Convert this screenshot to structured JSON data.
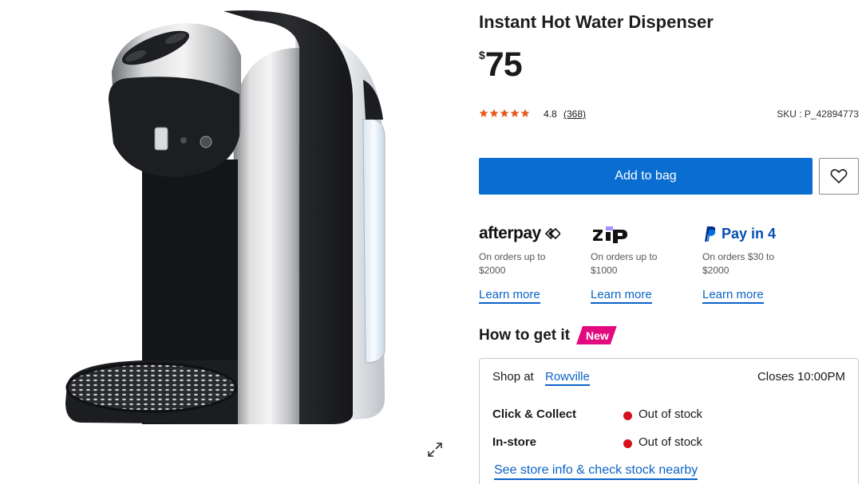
{
  "product": {
    "title": "Instant Hot Water Dispenser",
    "currency_symbol": "$",
    "price": "75",
    "rating": "4.8",
    "rating_count": "(368)",
    "stars": 5,
    "sku": "SKU : P_42894773"
  },
  "actions": {
    "add_to_bag": "Add to bag"
  },
  "payment_options": [
    {
      "name": "afterpay",
      "note_line1": "On orders up to",
      "note_line2": "$2000",
      "link": "Learn more"
    },
    {
      "name": "zip",
      "note_line1": "On orders up to",
      "note_line2": "$1000",
      "link": "Learn more"
    },
    {
      "name": "Pay in 4",
      "note_line1": "On orders $30 to",
      "note_line2": "$2000",
      "link": "Learn more"
    }
  ],
  "fulfilment": {
    "heading": "How to get it",
    "badge": "New",
    "shop_at_label": "Shop at",
    "store_name": "Rowville",
    "closes": "Closes 10:00PM",
    "rows": [
      {
        "label": "Click & Collect",
        "status": "Out of stock"
      },
      {
        "label": "In-store",
        "status": "Out of stock"
      }
    ],
    "store_info_link": "See store info & check stock nearby"
  },
  "colors": {
    "primary_button": "#0a6ed1",
    "link": "#0a63c7",
    "star": "#e8581b",
    "badge": "#e3097f",
    "out_of_stock": "#d4111c"
  },
  "icons": {
    "wishlist": "heart-icon",
    "expand": "expand-icon",
    "star": "star-icon"
  }
}
